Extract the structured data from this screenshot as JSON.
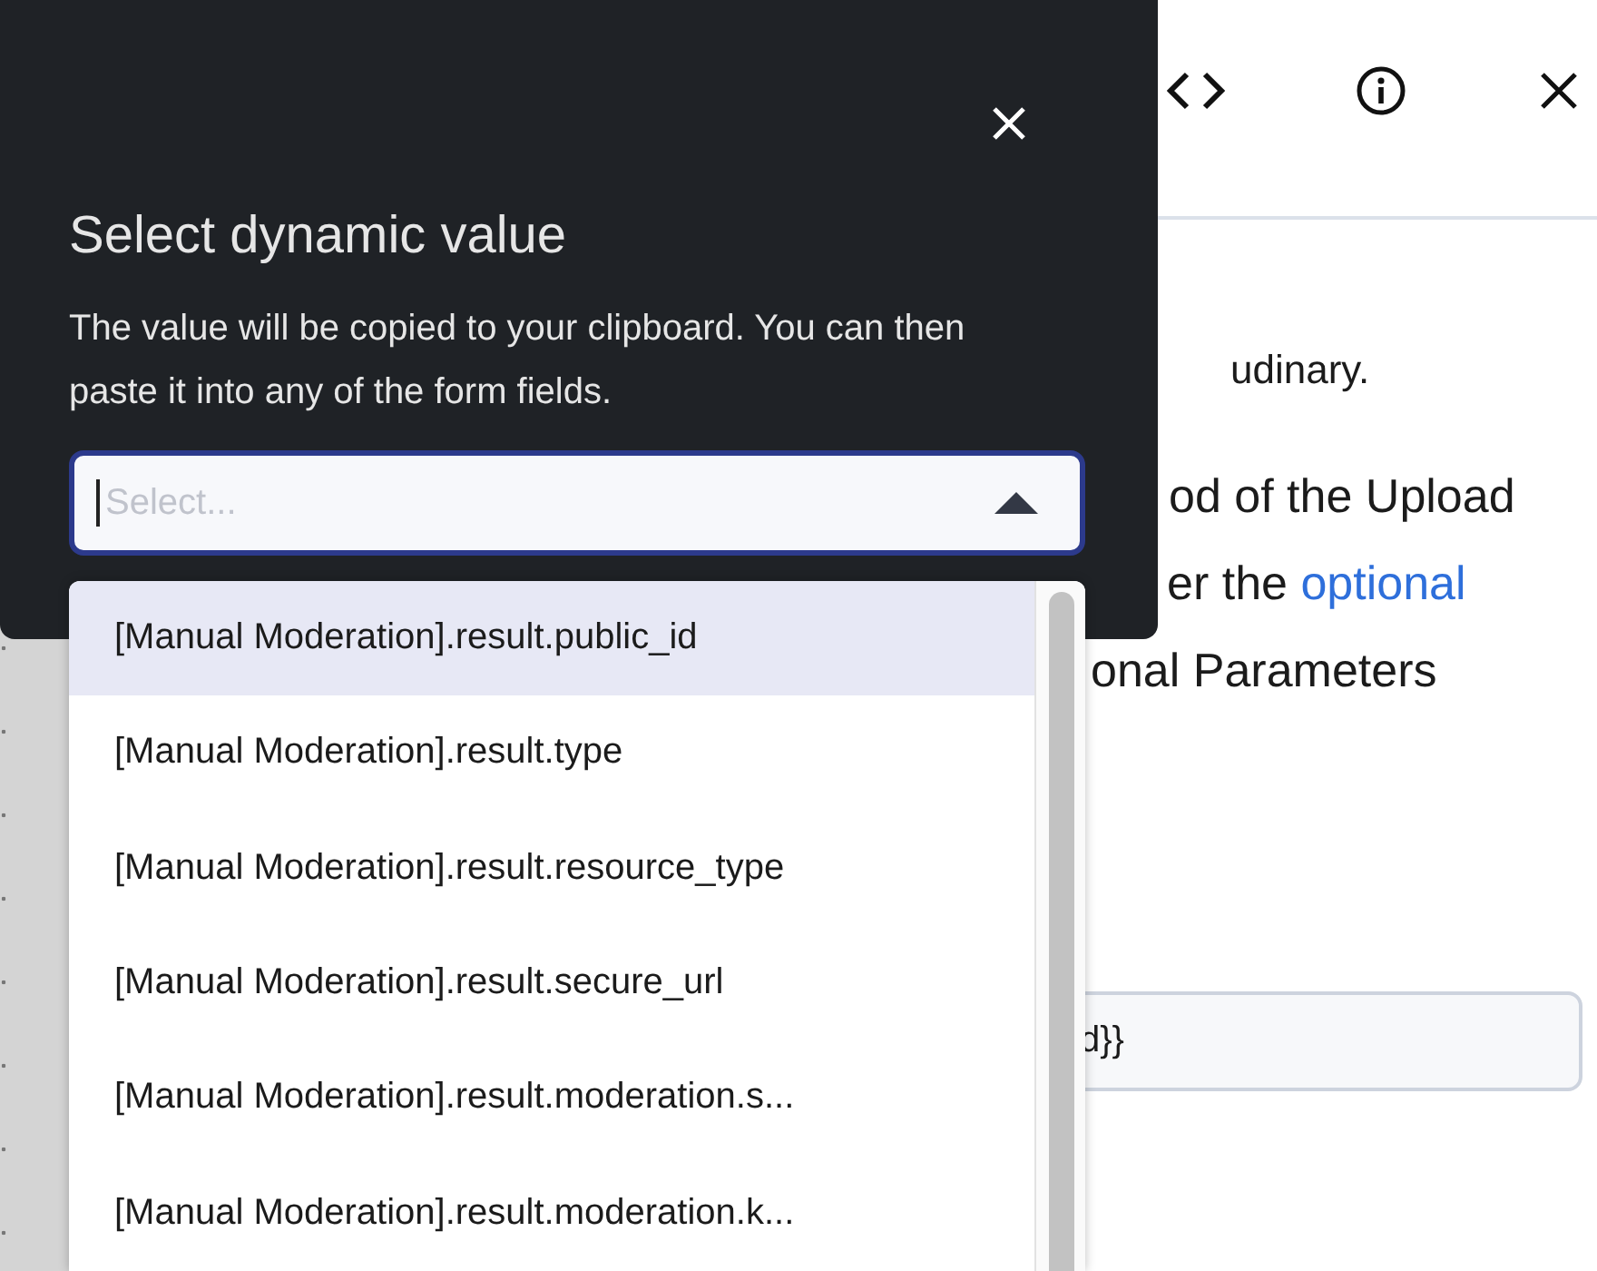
{
  "panel": {
    "lines": [
      {
        "parts": [
          {
            "kind": "text",
            "text": "udinary."
          }
        ]
      },
      {
        "parts": [
          {
            "kind": "text",
            "text": "od of the Upload"
          }
        ]
      },
      {
        "parts": [
          {
            "kind": "text",
            "text": "er the "
          },
          {
            "kind": "link",
            "text": "optional"
          }
        ]
      },
      {
        "parts": [
          {
            "kind": "text",
            "text": "onal Parameters"
          }
        ]
      }
    ],
    "field": {
      "value": "d}}"
    }
  },
  "popover": {
    "title": "Select dynamic value",
    "description": "The value will be copied to your clipboard. You can then paste it into any of the form fields.",
    "select": {
      "placeholder": "Select...",
      "expanded": true
    },
    "options": [
      {
        "label": "[Manual Moderation].result.public_id",
        "selected": true
      },
      {
        "label": "[Manual Moderation].result.type",
        "selected": false
      },
      {
        "label": "[Manual Moderation].result.resource_type",
        "selected": false
      },
      {
        "label": "[Manual Moderation].result.secure_url",
        "selected": false
      },
      {
        "label": "[Manual Moderation].result.moderation.s...",
        "selected": false
      },
      {
        "label": "[Manual Moderation].result.moderation.k...",
        "selected": false
      }
    ]
  }
}
